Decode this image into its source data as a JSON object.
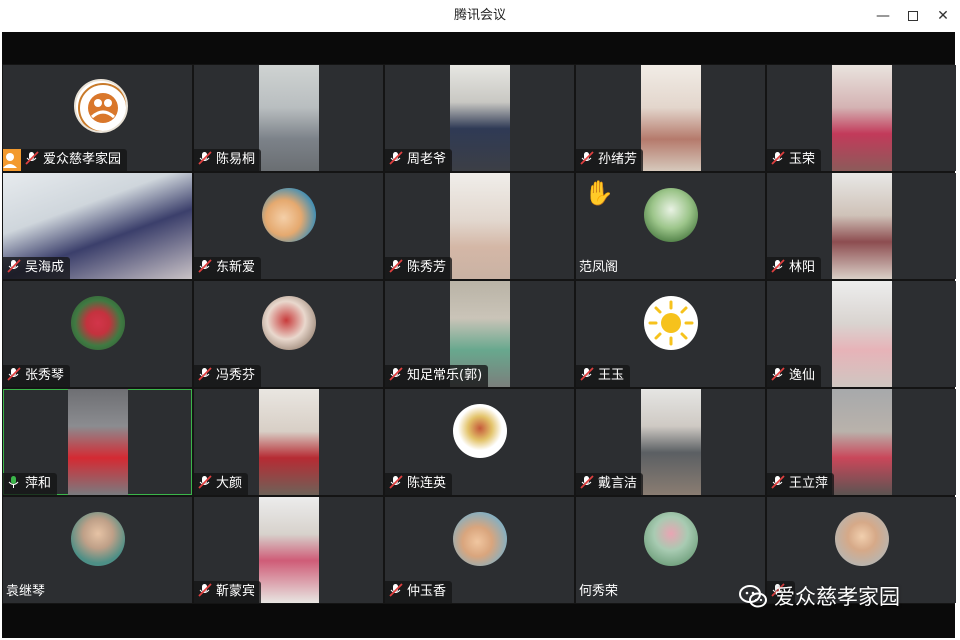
{
  "window": {
    "title": "腾讯会议"
  },
  "participants": [
    {
      "name": "爱众慈孝家园",
      "host": true
    },
    {
      "name": "陈易桐"
    },
    {
      "name": "周老爷"
    },
    {
      "name": "孙绪芳"
    },
    {
      "name": "玉荣"
    },
    {
      "name": "吴海成"
    },
    {
      "name": "东新爱"
    },
    {
      "name": "陈秀芳"
    },
    {
      "name": "范凤阁",
      "raised_hand": true
    },
    {
      "name": "林阳"
    },
    {
      "name": "张秀琴"
    },
    {
      "name": "冯秀芬"
    },
    {
      "name": "知足常乐(郭)"
    },
    {
      "name": "王玉"
    },
    {
      "name": "逸仙"
    },
    {
      "name": "萍和",
      "speaking": true
    },
    {
      "name": "大颜"
    },
    {
      "name": "陈连英"
    },
    {
      "name": "戴言洁"
    },
    {
      "name": "王立萍"
    },
    {
      "name": "袁继琴"
    },
    {
      "name": "靳蒙宾"
    },
    {
      "name": "仲玉香"
    },
    {
      "name": "何秀荣"
    },
    {
      "name": ""
    }
  ],
  "watermark": {
    "text": "爱众慈孝家园"
  },
  "colors": {
    "tile": "#2c2e31",
    "speaking": "#3bb54a",
    "host_badge": "#f39a2e",
    "mic_muted": "#e04040"
  },
  "icons": {
    "hand": "raised-hand-icon",
    "mic_off": "mic-muted-icon",
    "mic_on": "mic-active-icon"
  }
}
